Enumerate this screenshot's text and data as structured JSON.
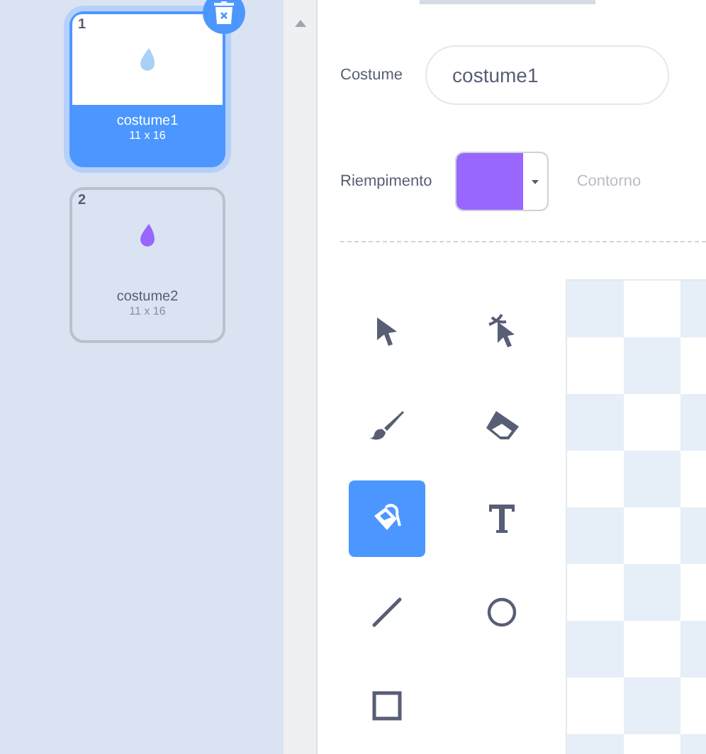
{
  "costumes": [
    {
      "number": "1",
      "name": "costume1",
      "size": "11 x 16",
      "selected": true,
      "color": "#a9d0f5"
    },
    {
      "number": "2",
      "name": "costume2",
      "size": "11 x 16",
      "selected": false,
      "color": "#9966ff"
    }
  ],
  "editor": {
    "name_label": "Costume",
    "name_value": "costume1",
    "fill_label": "Riempimento",
    "fill": {
      "color": "#9966ff"
    },
    "outline_label": "Contorno"
  },
  "tools": [
    {
      "kind": "select",
      "selected": false
    },
    {
      "kind": "reshape",
      "selected": false
    },
    {
      "kind": "brush",
      "selected": false
    },
    {
      "kind": "eraser",
      "selected": false
    },
    {
      "kind": "fill",
      "selected": true
    },
    {
      "kind": "text",
      "selected": false
    },
    {
      "kind": "line",
      "selected": false
    },
    {
      "kind": "circle",
      "selected": false
    },
    {
      "kind": "rectangle",
      "selected": false
    }
  ]
}
